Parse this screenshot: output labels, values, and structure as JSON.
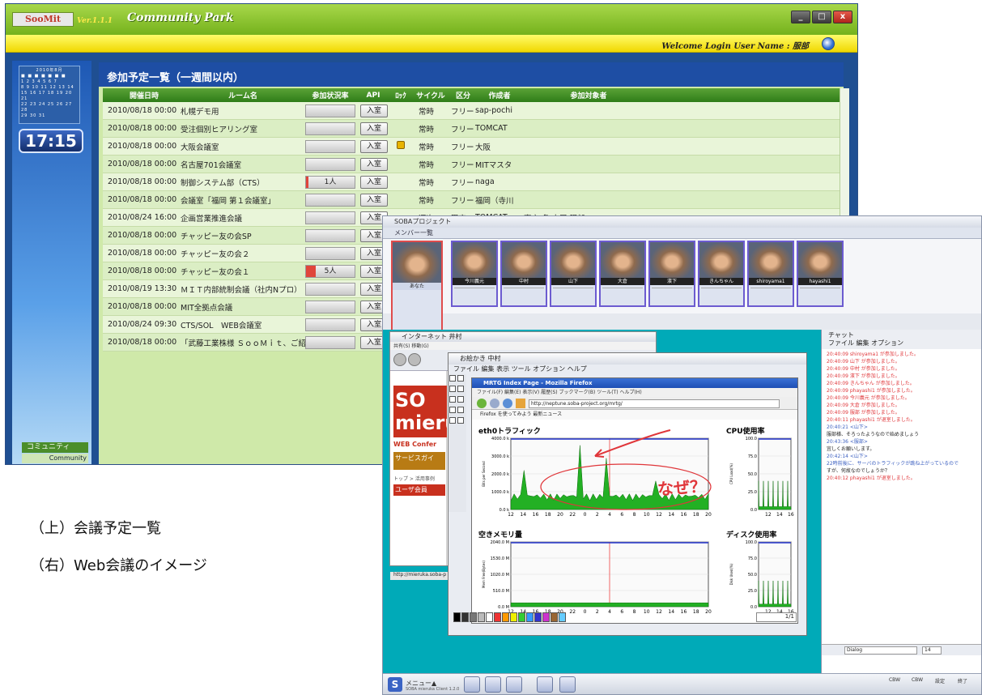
{
  "soomit": {
    "logo": "SooMit",
    "version": "Ver.1.1.1",
    "app_title": "Community Park",
    "welcome": "Welcome Login User Name : 服部",
    "window_controls": [
      "_",
      "□",
      "x"
    ],
    "clock": "17:15",
    "calendar_title": "2010年8月",
    "community_label": "コミュニティ",
    "community_sub": "Community",
    "heading": "参加予定一覧（一週間以内）",
    "columns": [
      "開催日時",
      "ルーム名",
      "参加状況率",
      "API",
      "ﾛｯｸ",
      "サイクル",
      "区分",
      "作成者",
      "参加対象者"
    ],
    "enter_label": "入室",
    "rows": [
      {
        "date": "2010/08/18 00:00",
        "room": "札幌デモ用",
        "status": "",
        "lock": false,
        "cycle": "常時",
        "kind": "フリー",
        "creator": "sap-pochi",
        "target": ""
      },
      {
        "date": "2010/08/18 00:00",
        "room": "受注個別ヒアリング室",
        "status": "",
        "lock": false,
        "cycle": "常時",
        "kind": "フリー",
        "creator": "TOMCAT",
        "target": ""
      },
      {
        "date": "2010/08/18 00:00",
        "room": "大阪会議室",
        "status": "",
        "lock": true,
        "cycle": "常時",
        "kind": "フリー",
        "creator": "大阪",
        "target": ""
      },
      {
        "date": "2010/08/18 00:00",
        "room": "名古屋701会議室",
        "status": "",
        "lock": false,
        "cycle": "常時",
        "kind": "フリー",
        "creator": "MITマスタ",
        "target": ""
      },
      {
        "date": "2010/08/18 00:00",
        "room": "制御システム部（CTS）",
        "status": "1人",
        "lock": false,
        "cycle": "常時",
        "kind": "フリー",
        "creator": "naga",
        "target": ""
      },
      {
        "date": "2010/08/18 00:00",
        "room": "会議室「福岡 第１会議室」",
        "status": "",
        "lock": false,
        "cycle": "常時",
        "kind": "フリー",
        "creator": "福岡（寺川",
        "target": ""
      },
      {
        "date": "2010/08/24 16:00",
        "room": "企画営業推進会議",
        "status": "",
        "lock": false,
        "cycle": "週次",
        "kind": "限定",
        "creator": "TOMCAT",
        "target": "東京 名 古屋 服部 TOMCAT sa"
      },
      {
        "date": "2010/08/18 00:00",
        "room": "チャッピー友の会SP",
        "status": "",
        "lock": false,
        "cycle": "",
        "kind": "",
        "creator": "",
        "target": ""
      },
      {
        "date": "2010/08/18 00:00",
        "room": "チャッピー友の会２",
        "status": "",
        "lock": false,
        "cycle": "",
        "kind": "",
        "creator": "",
        "target": ""
      },
      {
        "date": "2010/08/18 00:00",
        "room": "チャッピー友の会１",
        "status": "5人",
        "lock": false,
        "cycle": "",
        "kind": "",
        "creator": "",
        "target": ""
      },
      {
        "date": "2010/08/19 13:30",
        "room": "ＭＩＴ内部統制会議（社内Nプロ）",
        "status": "",
        "lock": false,
        "cycle": "",
        "kind": "",
        "creator": "",
        "target": ""
      },
      {
        "date": "2010/08/18 00:00",
        "room": "MIT全拠点会議",
        "status": "",
        "lock": false,
        "cycle": "",
        "kind": "",
        "creator": "",
        "target": ""
      },
      {
        "date": "2010/08/24 09:30",
        "room": "CTS/SOL　WEB会議室",
        "status": "",
        "lock": false,
        "cycle": "",
        "kind": "",
        "creator": "",
        "target": ""
      },
      {
        "date": "2010/08/18 00:00",
        "room": "「武藤工業株様 ＳｏｏＭｉｔ、ご紹",
        "status": "",
        "lock": false,
        "cycle": "",
        "kind": "",
        "creator": "",
        "target": ""
      }
    ]
  },
  "soba": {
    "window_title": "SOBAプロジェクト",
    "members_label": "メンバー一覧",
    "self_name": "あなた",
    "members": [
      "今川義元",
      "中村",
      "山下",
      "大倉",
      "濱下",
      "きんちゃん",
      "shiroyama1",
      "hayashi1"
    ],
    "ie_title": "インターネット  井村",
    "ie_menu": "共有(S)  移動(G)",
    "ie_logo": "SO mieru",
    "ie_web": "WEB Confer",
    "ie_service": "サービスガイ",
    "ie_breadcrumb": "トップ > 活用事例",
    "ie_user": "ユーザ会員",
    "ie_status": "http://mieruka.soba-p",
    "draw_title": "お絵かき  中村",
    "draw_menu": "ファイル  編集  表示  ツール  オプション  ヘルプ",
    "ff_title": "MRTG Index Page - Mozilla Firefox",
    "ff_menu": "ファイル(F)  編集(E)  表示(V)  履歴(S)  ブックマーク(B)  ツール(T)  ヘルプ(H)",
    "ff_url": "http://neptune.soba-project.org/mrtg/",
    "ff_bookmarks": "Firefox を使ってみよう   最新ニュース",
    "graphs": [
      {
        "title": "eth0トラフィック",
        "ylabel": "Bits per Second",
        "yticks": [
          "4000.0 k",
          "3000.0 k",
          "2000.0 k",
          "1000.0 k",
          "0.0 k"
        ]
      },
      {
        "title": "CPU使用率",
        "ylabel": "CPU Load(%)",
        "yticks": [
          "100.0",
          "75.0",
          "50.0",
          "25.0",
          "0.0"
        ]
      },
      {
        "title": "空きメモリ量",
        "ylabel": "Mem Free(Bytes)",
        "yticks": [
          "2040.0 M",
          "1530.0 M",
          "1020.0 M",
          "510.0 M",
          "0.0 M"
        ]
      },
      {
        "title": "ディスク使用率",
        "ylabel": "Disk Used(%)",
        "yticks": [
          "100.0",
          "75.0",
          "50.0",
          "25.0",
          "0.0"
        ]
      }
    ],
    "xticks": [
      "12",
      "14",
      "16",
      "18",
      "20",
      "22",
      "0",
      "2",
      "4",
      "6",
      "8",
      "10",
      "12",
      "14",
      "16",
      "18",
      "20"
    ],
    "annotation": "なぜ？",
    "draw_page": "1/1",
    "chat_title": "チャット",
    "chat_menu": "ファイル  編集  オプション",
    "chat_lines": [
      "20:40:09 shiroyama1 が参加しました。",
      "20:40:09 山下 が参加しました。",
      "20:40:09 中村 が参加しました。",
      "20:40:09 濱下 が参加しました。",
      "20:40:09 きんちゃん が参加しました。",
      "20:40:09 phayashi1 が参加しました。",
      "20:40:09 今川義元 が参加しました。",
      "20:40:09 大倉 が参加しました。",
      "20:40:09 服部 が参加しました。",
      "20:40:11 phayashi1 が退室しました。",
      "20:40:21 <山下>",
      "服部様、そろったようなので始めましょう",
      "20:43:36 <服部>",
      "宜しくお願いします。",
      "20:42:14 <山下>",
      "22時前後に、サーバのトラフィックが跳ね上がっているので",
      "すが、何故なのでしょうか？",
      "20:40:12 phayashi1 が退室しました。"
    ],
    "chat_font": "Dialog",
    "chat_size": "14",
    "taskbar_menu": "メニュー▲",
    "taskbar_sub": "SOBA mieruka Client 1.2.0",
    "taskbar_right": [
      "CBW",
      "CBW",
      "設定",
      "終了"
    ]
  },
  "captions": {
    "line1": "（上）会議予定一覧",
    "line2": "（右）Web会議のイメージ"
  },
  "colors": {
    "soomit_green": "#8cc63f",
    "soomit_blue": "#1f4f92",
    "grid_header": "#3f8f24",
    "chat_red": "#e0363a"
  }
}
